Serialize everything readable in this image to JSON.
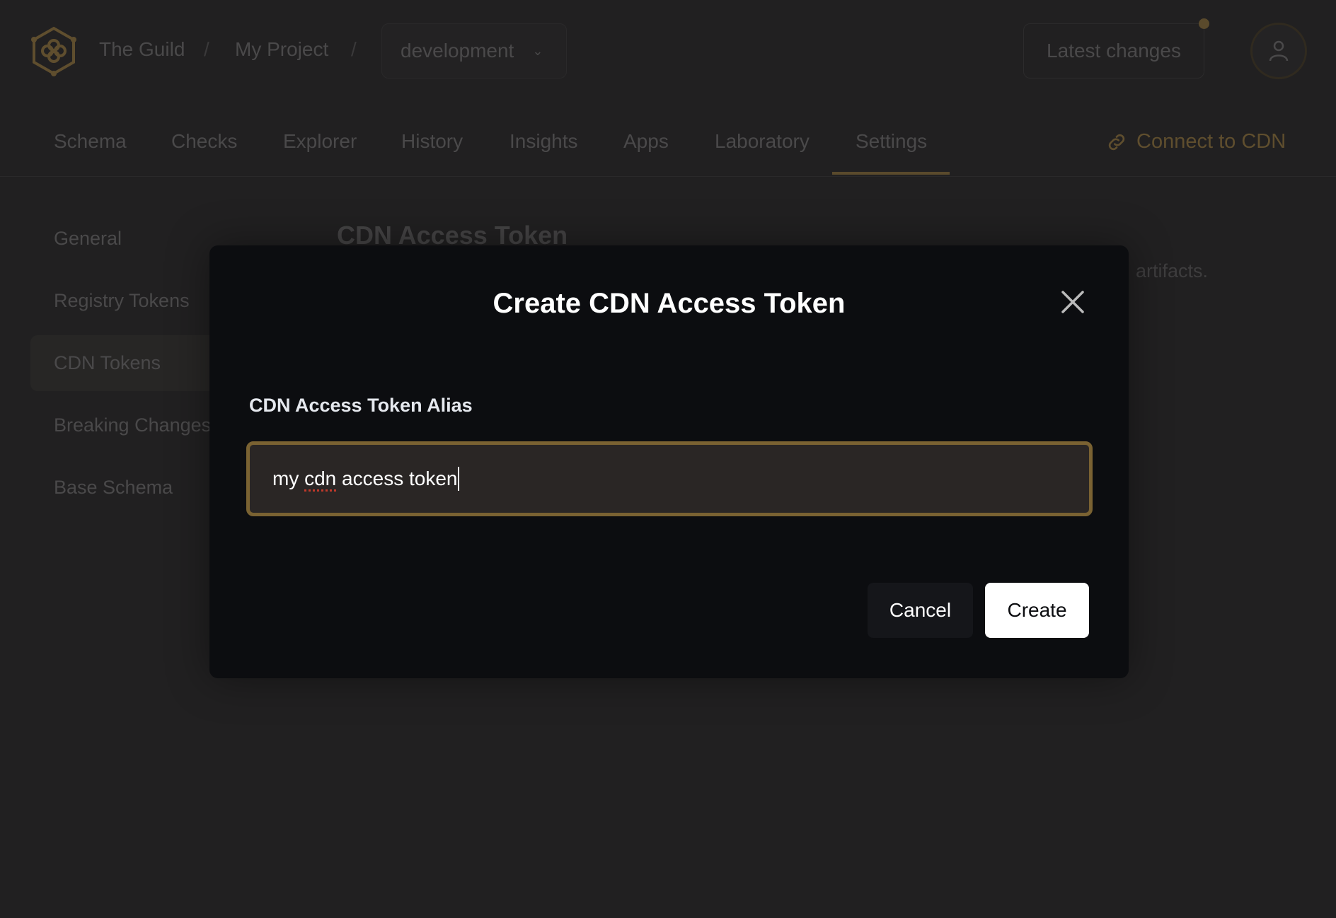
{
  "header": {
    "breadcrumb": [
      "The Guild",
      "My Project"
    ],
    "separator": "/",
    "environment": "development",
    "latest_changes": "Latest changes"
  },
  "nav": {
    "tabs": [
      "Schema",
      "Checks",
      "Explorer",
      "History",
      "Insights",
      "Apps",
      "Laboratory",
      "Settings"
    ],
    "active": "Settings",
    "connect_cdn": "Connect to CDN"
  },
  "sidebar": {
    "items": [
      "General",
      "Registry Tokens",
      "CDN Tokens",
      "Breaking Changes",
      "Base Schema"
    ],
    "active": "CDN Tokens"
  },
  "main": {
    "heading": "CDN Access Token",
    "description_fragment": "artifacts."
  },
  "modal": {
    "title": "Create CDN Access Token",
    "field_label": "CDN Access Token Alias",
    "input_value_prefix": "my ",
    "input_value_misspelled": "cdn",
    "input_value_suffix": " access token",
    "cancel": "Cancel",
    "create": "Create"
  },
  "colors": {
    "accent": "#7a6232",
    "modal_bg": "#0c0d10",
    "page_bg": "#212021"
  }
}
